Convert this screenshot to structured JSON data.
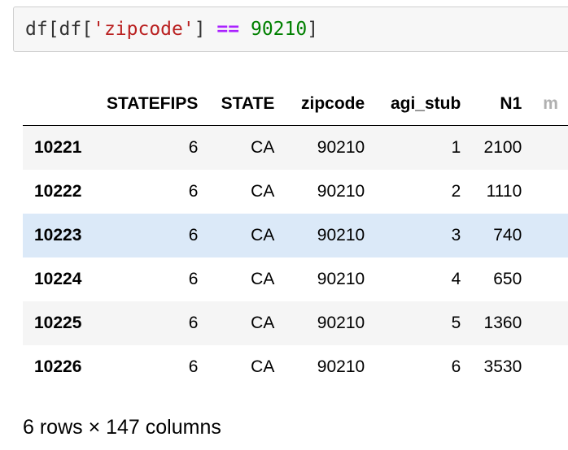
{
  "code_cell": {
    "tokens": {
      "prefix": "df[df[",
      "string": "'zipcode'",
      "mid": "] ",
      "operator": "==",
      "space": " ",
      "number": "90210",
      "suffix": "]"
    }
  },
  "table": {
    "columns": [
      "",
      "STATEFIPS",
      "STATE",
      "zipcode",
      "agi_stub",
      "N1",
      "m"
    ],
    "rows": [
      {
        "index": "10221",
        "cells": [
          "6",
          "CA",
          "90210",
          "1",
          "2100",
          ""
        ]
      },
      {
        "index": "10222",
        "cells": [
          "6",
          "CA",
          "90210",
          "2",
          "1110",
          ""
        ]
      },
      {
        "index": "10223",
        "cells": [
          "6",
          "CA",
          "90210",
          "3",
          "740",
          ""
        ],
        "hovered": true
      },
      {
        "index": "10224",
        "cells": [
          "6",
          "CA",
          "90210",
          "4",
          "650",
          ""
        ]
      },
      {
        "index": "10225",
        "cells": [
          "6",
          "CA",
          "90210",
          "5",
          "1360",
          ""
        ]
      },
      {
        "index": "10226",
        "cells": [
          "6",
          "CA",
          "90210",
          "6",
          "3530",
          ""
        ]
      }
    ]
  },
  "summary": "6 rows × 147 columns",
  "colors": {
    "string": "#ba2121",
    "operator": "#aa22ff",
    "number": "#008000",
    "row_stripe": "#f5f5f5",
    "row_hover": "#dbe9f8"
  }
}
